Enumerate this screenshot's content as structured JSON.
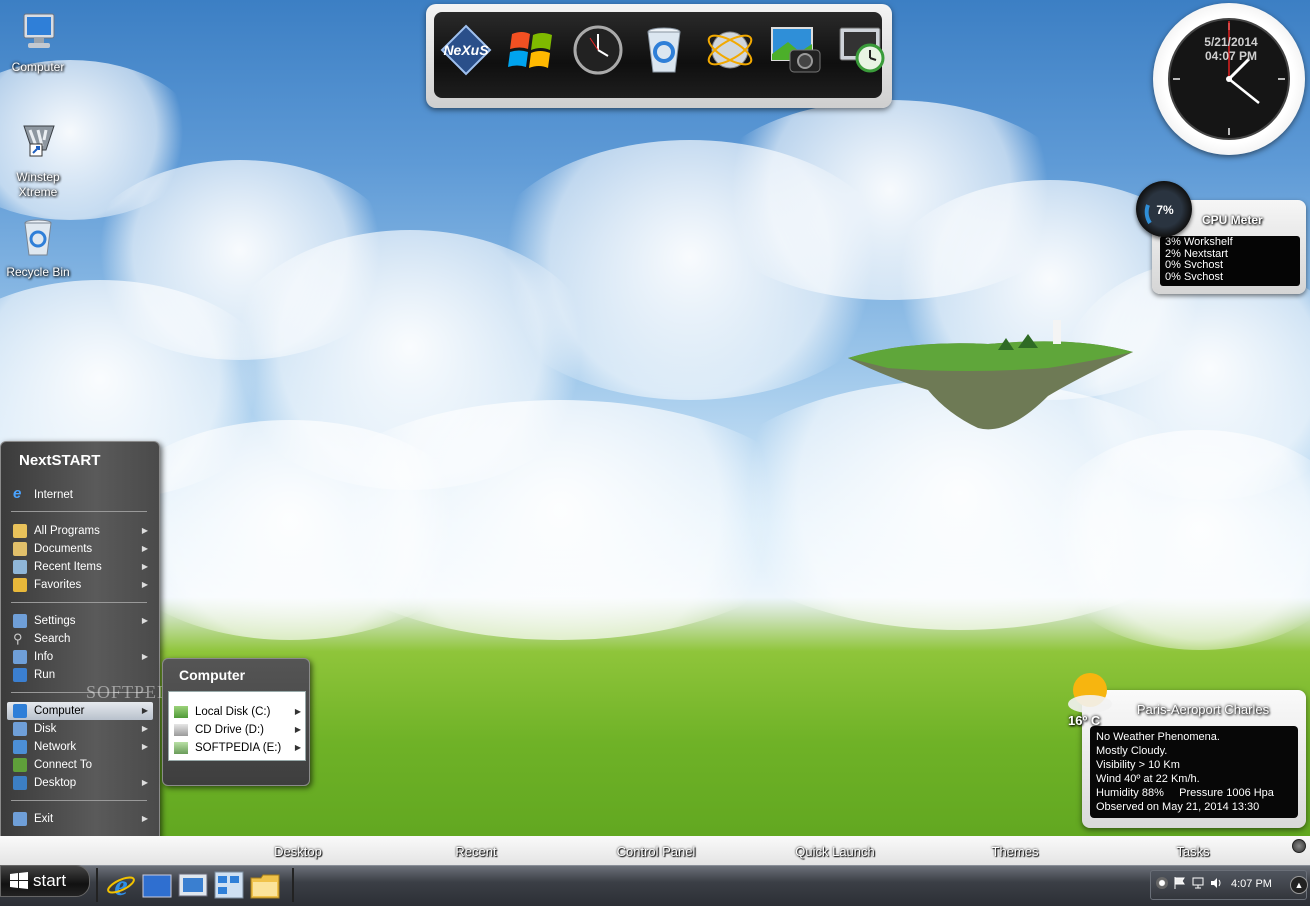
{
  "desktop_icons": [
    {
      "label": "Computer",
      "icon": "computer-icon"
    },
    {
      "label": "Winstep\nXtreme",
      "icon": "winstep-xtreme-icon"
    },
    {
      "label": "Recycle Bin",
      "icon": "recycle-bin-icon"
    }
  ],
  "dock": {
    "items": [
      "nexus-icon",
      "windows-logo-icon",
      "clock-icon",
      "recycle-bin-icon",
      "globe-icon",
      "camera-photo-icon",
      "system-monitor-icon"
    ],
    "nexus_text": "NeXuS"
  },
  "clock": {
    "date": "5/21/2014",
    "time": "04:07 PM"
  },
  "cpu_meter": {
    "title": "CPU Meter",
    "percent": "7%",
    "processes": [
      "3% Workshelf",
      "2% Nextstart",
      "0% Svchost",
      "0% Svchost"
    ]
  },
  "weather": {
    "location": "Paris-Aeroport Charles",
    "temperature": "16º C",
    "lines": [
      "No Weather Phenomena.",
      "Mostly Cloudy.",
      "Visibility > 10 Km",
      "Wind 40º at 22 Km/h.",
      "Humidity 88%     Pressure 1006 Hpa",
      "Observed on May 21, 2014 13:30"
    ]
  },
  "start_menu": {
    "title": "NextSTART",
    "items": [
      {
        "label": "Internet",
        "icon": "internet-explorer-icon",
        "arrow": false
      },
      {
        "label": "All Programs",
        "icon": "folder-icon",
        "arrow": true
      },
      {
        "label": "Documents",
        "icon": "documents-icon",
        "arrow": true
      },
      {
        "label": "Recent Items",
        "icon": "recent-items-icon",
        "arrow": true
      },
      {
        "label": "Favorites",
        "icon": "favorites-icon",
        "arrow": true
      },
      {
        "label": "Settings",
        "icon": "settings-icon",
        "arrow": true
      },
      {
        "label": "Search",
        "icon": "search-icon",
        "arrow": false
      },
      {
        "label": "Info",
        "icon": "info-icon",
        "arrow": true
      },
      {
        "label": "Run",
        "icon": "run-icon",
        "arrow": false
      },
      {
        "label": "Computer",
        "icon": "computer-icon",
        "arrow": true,
        "selected": true
      },
      {
        "label": "Disk",
        "icon": "disk-icon",
        "arrow": true
      },
      {
        "label": "Network",
        "icon": "network-icon",
        "arrow": true
      },
      {
        "label": "Connect To",
        "icon": "connect-to-icon",
        "arrow": false
      },
      {
        "label": "Desktop",
        "icon": "desktop-icon",
        "arrow": true
      },
      {
        "label": "Exit",
        "icon": "exit-icon",
        "arrow": true
      }
    ]
  },
  "submenu": {
    "title": "Computer",
    "items": [
      {
        "label": "Local Disk (C:)",
        "icon": "local-disk-icon"
      },
      {
        "label": "CD Drive (D:)",
        "icon": "cd-drive-icon"
      },
      {
        "label": "SOFTPEDIA (E:)",
        "icon": "network-drive-icon"
      }
    ]
  },
  "watermark": "SOFTPEDIA",
  "toolbar": {
    "items": [
      "Desktop",
      "Recent",
      "Control Panel",
      "Quick Launch",
      "Themes",
      "Tasks"
    ]
  },
  "taskbar": {
    "start_label": "start",
    "quick_launch": [
      "internet-explorer-icon",
      "show-desktop-icon",
      "switch-windows-icon",
      "network-connections-icon",
      "file-explorer-icon"
    ],
    "tray_icons": [
      "info-icon",
      "flag-icon",
      "network-icon",
      "volume-icon"
    ],
    "time": "4:07 PM"
  },
  "colors": {
    "selection": "#c8d0da",
    "dock_bg": "#1a1a1a",
    "tray_bg": "#3b3f46"
  }
}
